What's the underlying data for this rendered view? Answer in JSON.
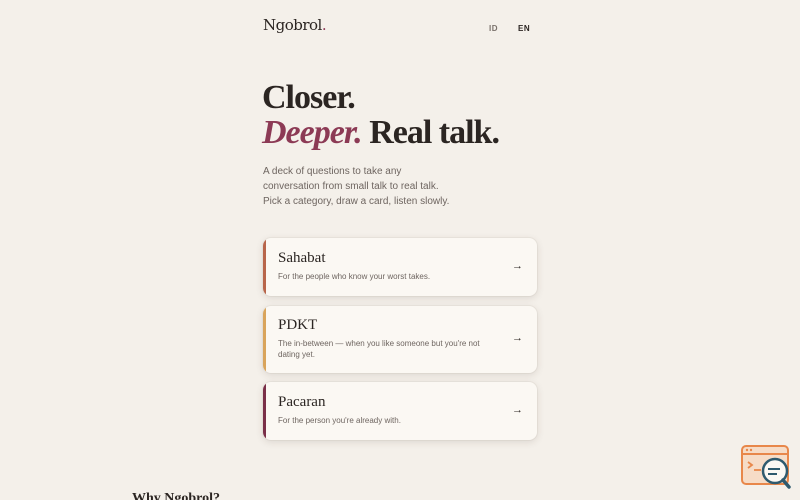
{
  "header": {
    "logo": "Ngobrol",
    "logo_dot": ".",
    "lang_id": "ID",
    "lang_en": "EN"
  },
  "hero": {
    "line1": "Closer.",
    "line2_accent": "Deeper.",
    "line2_rest": " Real talk.",
    "subtitle_1": "A deck of questions to take any",
    "subtitle_2": "conversation from small talk to real talk.",
    "subtitle_3": "Pick a category, draw a card, listen slowly."
  },
  "categories": [
    {
      "title": "Sahabat",
      "desc": "For the people who know your worst takes.",
      "color": "#b8654a",
      "arrow": "→"
    },
    {
      "title": "PDKT",
      "desc": "The in-between — when you like someone but you're not dating yet.",
      "color": "#d9a45b",
      "arrow": "→"
    },
    {
      "title": "Pacaran",
      "desc": "For the person you're already with.",
      "color": "#7a2f48",
      "arrow": "→"
    }
  ],
  "section": {
    "why_title": "Why Ngobrol?"
  },
  "colors": {
    "background": "#f4f0ea",
    "accent": "#8c3a55",
    "card": "#fbf8f3"
  },
  "icons": {
    "corner_badge": "code-search-icon"
  }
}
